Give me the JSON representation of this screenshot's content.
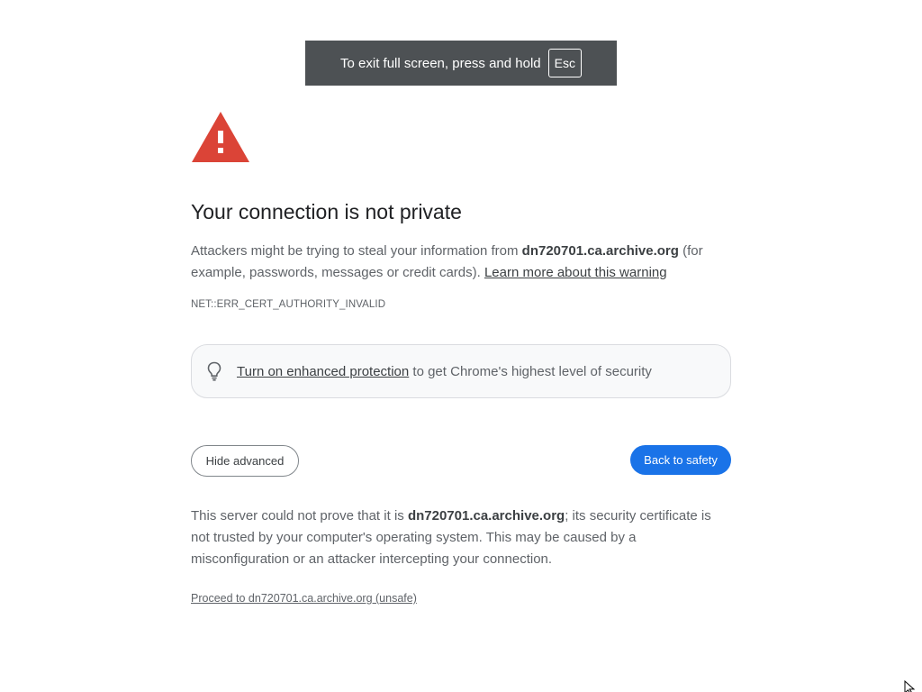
{
  "fullscreen_toast": {
    "message": "To exit full screen, press and hold",
    "key": "Esc"
  },
  "icons": {
    "warning": "warning-triangle-icon",
    "bulb": "lightbulb-icon",
    "cursor": "mouse-pointer-icon"
  },
  "colors": {
    "warning_red": "#db4437",
    "primary_blue": "#1a73e8"
  },
  "interstitial": {
    "title": "Your connection is not private",
    "intro_prefix": "Attackers might be trying to steal your information from ",
    "host": "dn720701.ca.archive.org",
    "intro_suffix": " (for example, passwords, messages or credit cards). ",
    "learn_more": "Learn more about this warning",
    "error_code": "NET::ERR_CERT_AUTHORITY_INVALID",
    "enhanced_link": "Turn on enhanced protection",
    "enhanced_rest": " to get Chrome's highest level of security",
    "hide_advanced": "Hide advanced",
    "back_to_safety": "Back to safety",
    "details_prefix": "This server could not prove that it is ",
    "details_suffix": "; its security certificate is not trusted by your computer's operating system. This may be caused by a misconfiguration or an attacker intercepting your connection.",
    "proceed_link": "Proceed to dn720701.ca.archive.org (unsafe)"
  }
}
